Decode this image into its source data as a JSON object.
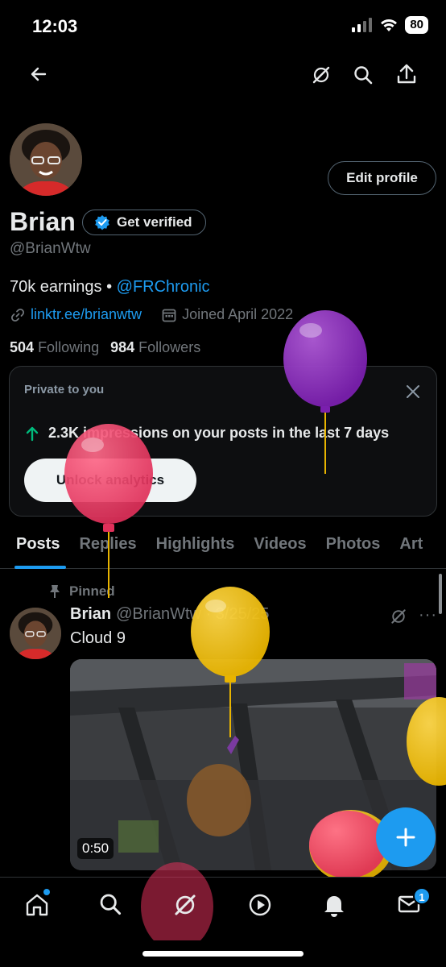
{
  "status_bar": {
    "time": "12:03",
    "battery": "80"
  },
  "profile": {
    "display_name": "Brian",
    "handle": "@BrianWtw",
    "edit_button": "Edit profile",
    "verified_button": "Get verified",
    "bio_text": "70k earnings • ",
    "bio_mention": "@FRChronic",
    "link": "linktr.ee/brianwtw",
    "joined": "Joined April 2022",
    "following_count": "504",
    "following_label": "Following",
    "followers_count": "984",
    "followers_label": "Followers"
  },
  "private_card": {
    "title": "Private to you",
    "stat": "2.3K impressions on your posts in the last 7 days",
    "button": "Unlock analytics"
  },
  "tabs": [
    "Posts",
    "Replies",
    "Highlights",
    "Videos",
    "Photos",
    "Art"
  ],
  "post": {
    "pinned_label": "Pinned",
    "author": "Brian",
    "meta": "@BrianWtw · 3/25/25",
    "text": "Cloud 9",
    "duration": "0:50",
    "more": "···"
  },
  "bottom_nav": {
    "message_badge": "1"
  },
  "colors": {
    "accent": "#1d9bf0",
    "background": "#000000",
    "muted": "#71767b"
  },
  "icons": [
    "back-arrow-icon",
    "grok-icon",
    "search-icon",
    "share-icon",
    "verified-badge-icon",
    "link-icon",
    "calendar-icon",
    "close-icon",
    "arrow-up-icon",
    "pin-icon",
    "plus-icon",
    "home-icon",
    "play-icon",
    "bell-icon",
    "mail-icon"
  ]
}
